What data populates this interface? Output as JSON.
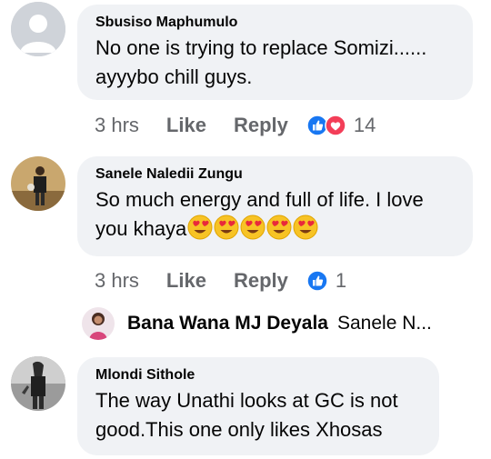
{
  "comments": [
    {
      "author": "Sbusiso Maphumulo",
      "text_line1": "No one is trying to replace Somizi......",
      "text_line2": "ayyybo chill guys.",
      "time": "3 hrs",
      "like_label": "Like",
      "reply_label": "Reply",
      "reaction_count": "14",
      "reactions": [
        "like-icon",
        "love-icon"
      ],
      "avatar": "default-avatar-icon"
    },
    {
      "author": "Sanele Naledii Zungu",
      "text_line1": "So much energy and full of life. I love",
      "text_line2": "you khaya",
      "emojis": [
        "heart-eyes-emoji",
        "heart-eyes-emoji",
        "heart-eyes-emoji",
        "heart-eyes-emoji",
        "heart-eyes-emoji"
      ],
      "time": "3 hrs",
      "like_label": "Like",
      "reply_label": "Reply",
      "reaction_count": "1",
      "reactions": [
        "like-icon"
      ],
      "avatar": "photo-avatar"
    },
    {
      "author": "Mlondi Sithole",
      "text_line1": "The way Unathi looks at GC is not",
      "text_line2": "good.This one only likes Xhosas",
      "avatar": "photo-avatar"
    }
  ],
  "reply_preview": {
    "author": "Bana Wana MJ Deyala",
    "text": "Sanele N...",
    "avatar": "photo-avatar"
  },
  "colors": {
    "bubble": "#f0f2f5",
    "secondary_text": "#65676b",
    "like_blue": "#1877f2",
    "love_red": "#f33e58"
  }
}
